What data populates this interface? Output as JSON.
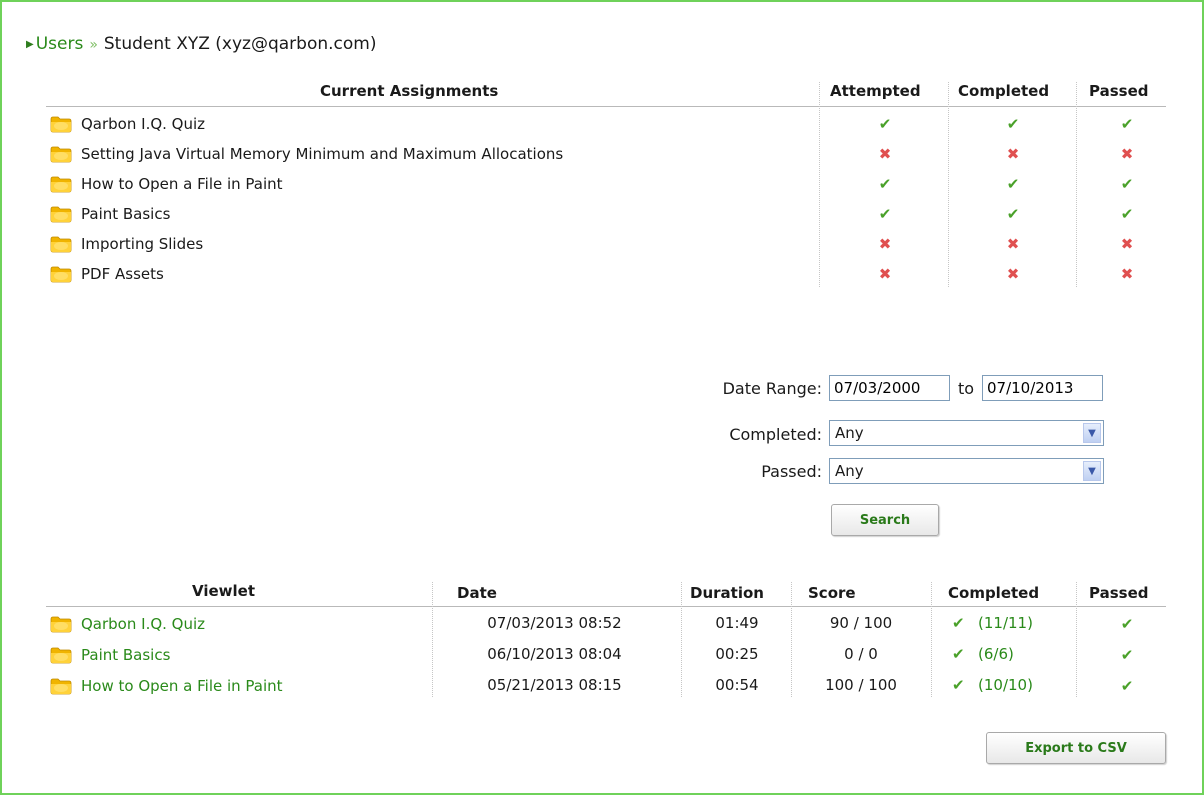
{
  "breadcrumb": {
    "parent": "Users",
    "separator": "»",
    "current": "Student XYZ (xyz@qarbon.com)"
  },
  "assignments": {
    "headers": {
      "title": "Current Assignments",
      "attempted": "Attempted",
      "completed": "Completed",
      "passed": "Passed"
    },
    "rows": [
      {
        "title": "Qarbon I.Q. Quiz",
        "attempted": true,
        "completed": true,
        "passed": true
      },
      {
        "title": "Setting Java Virtual Memory Minimum and Maximum Allocations",
        "attempted": false,
        "completed": false,
        "passed": false
      },
      {
        "title": "How to Open a File in Paint",
        "attempted": true,
        "completed": true,
        "passed": true
      },
      {
        "title": "Paint Basics",
        "attempted": true,
        "completed": true,
        "passed": true
      },
      {
        "title": "Importing Slides",
        "attempted": false,
        "completed": false,
        "passed": false
      },
      {
        "title": "PDF Assets",
        "attempted": false,
        "completed": false,
        "passed": false
      }
    ]
  },
  "filters": {
    "date_range_label": "Date Range:",
    "date_from": "07/03/2000",
    "to_label": "to",
    "date_to": "07/10/2013",
    "completed_label": "Completed:",
    "completed_value": "Any",
    "passed_label": "Passed:",
    "passed_value": "Any",
    "search_label": "Search"
  },
  "viewlets": {
    "headers": {
      "viewlet": "Viewlet",
      "date": "Date",
      "duration": "Duration",
      "score": "Score",
      "completed": "Completed",
      "passed": "Passed"
    },
    "rows": [
      {
        "title": "Qarbon I.Q. Quiz",
        "date": "07/03/2013 08:52",
        "duration": "01:49",
        "score": "90 / 100",
        "completed": "(11/11)",
        "passed": true
      },
      {
        "title": "Paint Basics",
        "date": "06/10/2013 08:04",
        "duration": "00:25",
        "score": "0 / 0",
        "completed": "(6/6)",
        "passed": true
      },
      {
        "title": "How to Open a File in Paint",
        "date": "05/21/2013 08:15",
        "duration": "00:54",
        "score": "100 / 100",
        "completed": "(10/10)",
        "passed": true
      }
    ]
  },
  "export_label": "Export to CSV",
  "icons": {
    "check": "✔",
    "cross": "✖",
    "arrow": "▸",
    "dropdown": "▾"
  },
  "colors": {
    "accent": "#2a8a1a",
    "border": "#6fd25a",
    "fail": "#e05050"
  }
}
